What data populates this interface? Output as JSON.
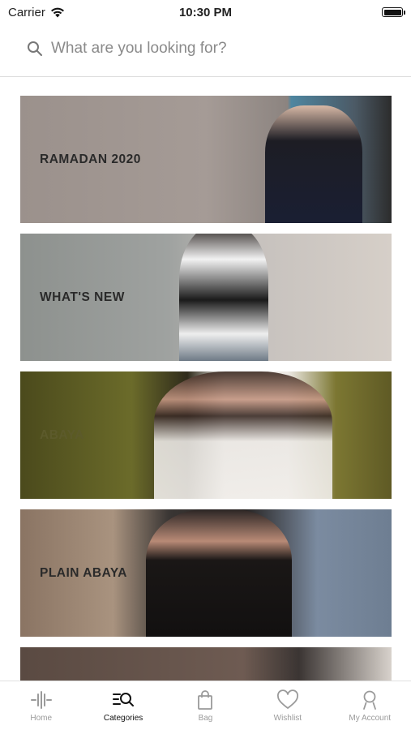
{
  "status_bar": {
    "carrier": "Carrier",
    "time": "10:30 PM"
  },
  "search": {
    "placeholder": "What are you looking for?"
  },
  "categories": [
    {
      "label": "RAMADAN 2020"
    },
    {
      "label": "WHAT'S NEW"
    },
    {
      "label": "ABAYA"
    },
    {
      "label": "PLAIN ABAYA"
    },
    {
      "label": ""
    }
  ],
  "tab_bar": {
    "items": [
      {
        "label": "Home",
        "icon": "home-bars-icon",
        "active": false
      },
      {
        "label": "Categories",
        "icon": "categories-search-icon",
        "active": true
      },
      {
        "label": "Bag",
        "icon": "bag-icon",
        "active": false
      },
      {
        "label": "Wishlist",
        "icon": "heart-icon",
        "active": false
      },
      {
        "label": "My Account",
        "icon": "user-icon",
        "active": false
      }
    ]
  }
}
